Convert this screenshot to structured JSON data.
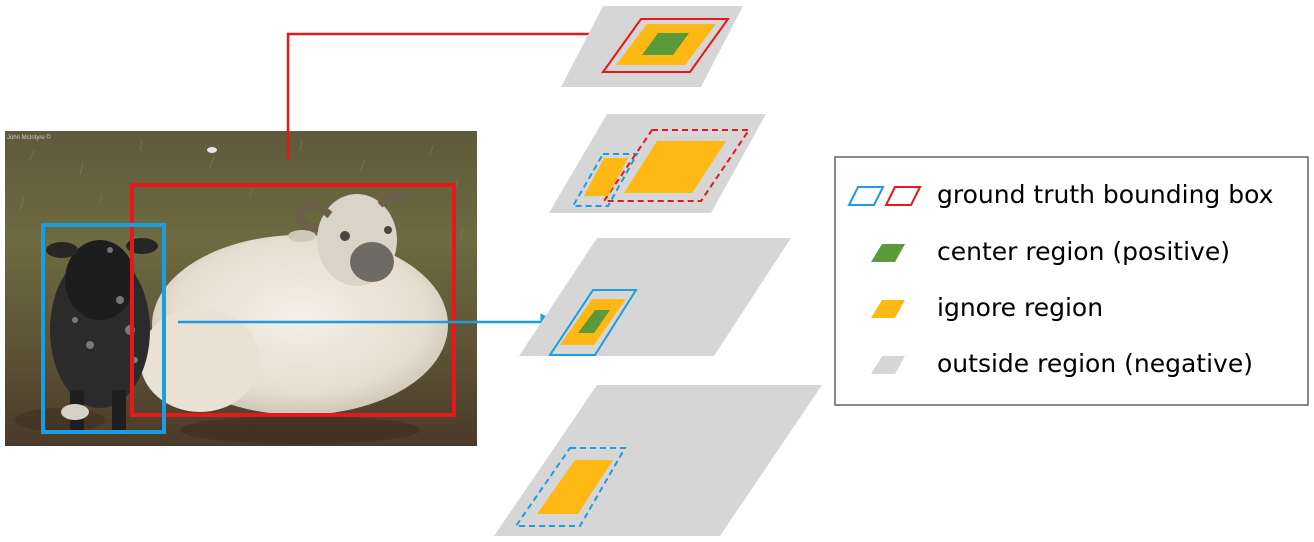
{
  "photo": {
    "subject": "lamb and sheep lying in a grassy field",
    "watermark_text": "John McIntyre ©"
  },
  "colors": {
    "red_box": "#e8171b",
    "blue_box": "#1a9ee0",
    "center_region": "#5a9a3a",
    "ignore_region": "#fdb813",
    "outside_region": "#d6d6d6",
    "legend_border": "#606060"
  },
  "feature_levels": [
    {
      "level": 1,
      "contents": [
        "red ground truth box",
        "ignore region",
        "center region"
      ]
    },
    {
      "level": 2,
      "contents": [
        "dashed blue box",
        "dashed red box",
        "ignore regions"
      ]
    },
    {
      "level": 3,
      "contents": [
        "blue ground truth box",
        "ignore region",
        "center region"
      ]
    },
    {
      "level": 4,
      "contents": [
        "dashed blue box",
        "ignore region"
      ]
    }
  ],
  "legend": {
    "items": [
      {
        "icon": "ground-truth-box-icon",
        "label": "ground truth bounding box"
      },
      {
        "icon": "center-region-icon",
        "label": "center region (positive)"
      },
      {
        "icon": "ignore-region-icon",
        "label": "ignore region"
      },
      {
        "icon": "outside-region-icon",
        "label": "outside region (negative)"
      }
    ]
  }
}
